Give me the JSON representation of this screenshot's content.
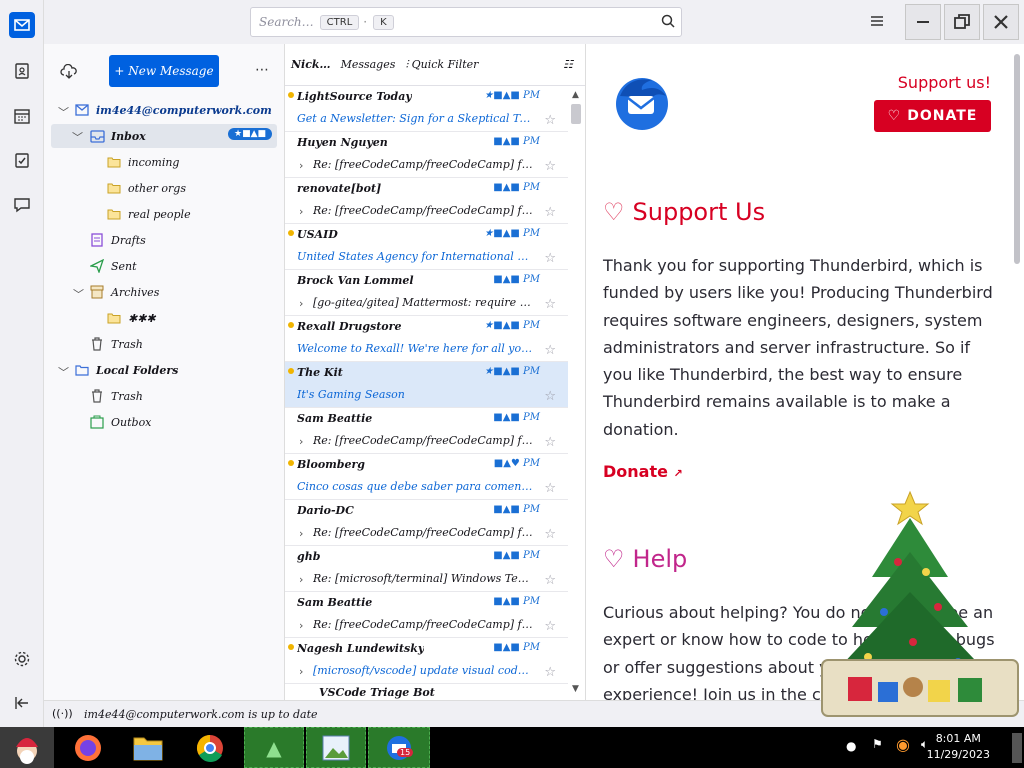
{
  "search": {
    "placeholder": "Search…",
    "k1": "CTRL",
    "k2": "K"
  },
  "folders": {
    "new_message": "+ New Message",
    "account": "im4e44@computerwork.com",
    "inbox": "Inbox",
    "inbox_badge": "★■▲■",
    "sub1": "incoming",
    "sub2": "other orgs",
    "sub3": "real people",
    "drafts": "Drafts",
    "sent": "Sent",
    "archives": "Archives",
    "archive_year": "✱✱✱",
    "trash": "Trash",
    "local": "Local Folders",
    "local_trash": "Trash",
    "outbox": "Outbox"
  },
  "list_header": {
    "col1": "Nick…",
    "col2": "Messages",
    "col3": "Quick Filter"
  },
  "messages": [
    {
      "from": "LightSource Today",
      "subject": "Get a Newsletter: Sign for a Skeptical Tec…",
      "date": "★■▲■ PM",
      "unread": true,
      "thread": false
    },
    {
      "from": "Huyen Nguyen",
      "subject": "Re: [freeCodeCamp/freeCodeCamp] feat…",
      "date": "■▲■ PM",
      "unread": false,
      "thread": true
    },
    {
      "from": "renovate[bot]",
      "subject": "Re: [freeCodeCamp/freeCodeCamp] feat(…",
      "date": "■▲■ PM",
      "unread": false,
      "thread": true
    },
    {
      "from": "USAID",
      "subject": "United States Agency for International De…",
      "date": "★■▲■ PM",
      "unread": true,
      "thread": false
    },
    {
      "from": "Brock Van Lommel",
      "subject": "[go-gitea/gitea] Mattermost: require all o…",
      "date": "■▲■ PM",
      "unread": false,
      "thread": true
    },
    {
      "from": "Rexall Drugstore",
      "subject": "Welcome to Rexall! We're here for all your…",
      "date": "★■▲■ PM",
      "unread": true,
      "thread": false
    },
    {
      "from": "The Kit",
      "subject": "It's Gaming Season",
      "date": "★■▲■ PM",
      "unread": true,
      "thread": false,
      "selected": true
    },
    {
      "from": "Sam Beattie",
      "subject": "Re: [freeCodeCamp/freeCodeCamp] feat(…",
      "date": "■▲■ PM",
      "unread": false,
      "thread": true
    },
    {
      "from": "Bloomberg",
      "subject": "Cinco cosas que debe saber para comenzar el …",
      "date": "■▲♥ PM",
      "unread": true,
      "thread": false
    },
    {
      "from": "Dario-DC",
      "subject": "Re: [freeCodeCamp/freeCodeCamp] feat…",
      "date": "■▲■ PM",
      "unread": false,
      "thread": true
    },
    {
      "from": "ghb",
      "subject": "Re: [microsoft/terminal] Windows Term…",
      "date": "■▲■ PM",
      "unread": false,
      "thread": true
    },
    {
      "from": "Sam Beattie",
      "subject": "Re: [freeCodeCamp/freeCodeCamp] feat(…",
      "date": "■▲■ PM",
      "unread": false,
      "thread": true
    },
    {
      "from": "Nagesh Lundewitsky",
      "subject": "[microsoft/vscode] update visual code (Vis…",
      "date": "■▲■ PM",
      "unread": true,
      "thread": true
    }
  ],
  "list_last": "VSCode Triage Bot",
  "preview": {
    "support_link": "Support us!",
    "donate_btn": "DONATE",
    "h_support": "Support Us",
    "p1": "Thank you for supporting Thunderbird, which is funded by users like you! Producing Thunderbird requires software engineers, designers, system administrators and server infrastructure. So if you like Thunderbird, the best way to ensure Thunderbird remains available is to make a donation.",
    "donate_link": "Donate",
    "h_help": "Help",
    "p2": "Curious about helping? You do not need to be an expert or know how to code to help. Report bugs or offer suggestions about your Thunderbird experience! Join us in the community."
  },
  "status": {
    "text": "im4e44@computerwork.com is up to date"
  },
  "taskbar": {
    "time": "8:01 AM",
    "date": "11/29/2023",
    "badge": "15"
  },
  "colors": {
    "accent": "#0061e0",
    "donate": "#d70022",
    "selected": "#dbe8f9"
  }
}
